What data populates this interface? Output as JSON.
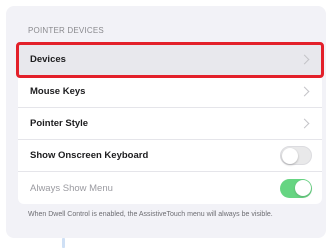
{
  "section": {
    "header": "POINTER DEVICES"
  },
  "rows": [
    {
      "label": "Devices",
      "accessory": "chevron"
    },
    {
      "label": "Mouse Keys",
      "accessory": "chevron"
    },
    {
      "label": "Pointer Style",
      "accessory": "chevron"
    },
    {
      "label": "Show Onscreen Keyboard",
      "accessory": "toggle",
      "toggle_on": false
    },
    {
      "label": "Always Show Menu",
      "accessory": "toggle",
      "toggle_on": true,
      "disabled": true
    }
  ],
  "footer": {
    "note": "When Dwell Control is enabled, the AssistiveTouch menu will always be visible."
  },
  "icons": {
    "chevron": "chevron-right-icon"
  },
  "colors": {
    "highlight_border": "#e3202a",
    "toggle_on": "#34c759",
    "background": "#f2f2f7"
  }
}
